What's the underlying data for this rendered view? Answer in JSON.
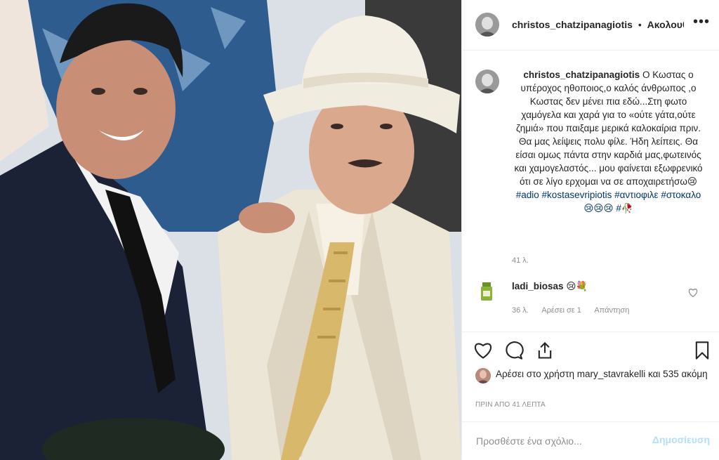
{
  "header": {
    "username": "christos_chatzipanagiotis",
    "follow_label": "Ακολουθείτε",
    "more_icon": "more-horizontal-icon"
  },
  "caption": {
    "username": "christos_chatzipanagiotis",
    "text": "Ο Κωστας ο υπέροχος ηθοποιος,ο καλός άνθρωπος ,ο Κωστας δεν μένει πια εδώ...Στη φωτο χαμόγελα και χαρά για το «ούτε γάτα,ούτε ζημιά» που παιξαμε μερικά καλοκαίρια πριν. Θα μας λείψεις πολυ φίλε. Ήδη λείπεις. Θα είσαι ομως πάντα στην καρδιά μας,φωτεινός και χαμογελαστός... μου φαίνεται εξωφρενικό ότι σε λίγο ερχομαι να σε αποχαιρετήσω😢",
    "tags": [
      "#adio",
      "#kostasevripiotis",
      "#αντιοφιλε",
      "#στοκαλο"
    ],
    "tail_emoji": "😢😢😢 #🥀",
    "time": "41 λ."
  },
  "comment": {
    "username": "ladi_biosas",
    "text": "😢💐",
    "time": "36 λ.",
    "likes": "Αρέσει σε 1",
    "reply": "Απάντηση"
  },
  "actions": {
    "like_icon": "heart-icon",
    "comment_icon": "comment-icon",
    "share_icon": "share-icon",
    "save_icon": "bookmark-icon"
  },
  "likes": {
    "prefix": "Αρέσει στο χρήστη",
    "user": "mary_stavrakelli",
    "suffix": "και 535 ακόμη"
  },
  "post_time": "ΠΡΙΝ ΑΠΟ 41 ΛΕΠΤΑ",
  "add_comment": {
    "placeholder": "Προσθέστε ένα σχόλιο...",
    "post_label": "Δημοσίευση"
  },
  "colors": {
    "text": "#262626",
    "muted": "#8e8e8e",
    "link": "#00376b",
    "post_disabled": "#b2dffc",
    "border": "#efefef"
  }
}
